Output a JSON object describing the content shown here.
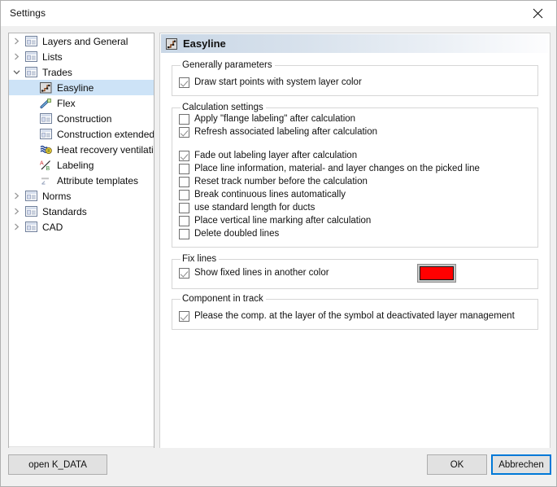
{
  "window": {
    "title": "Settings",
    "close_icon": "close-icon"
  },
  "tree": {
    "items": [
      {
        "label": "Layers and General",
        "level": 0,
        "expander": "collapsed",
        "icon": "window-list-icon",
        "selected": false
      },
      {
        "label": "Lists",
        "level": 0,
        "expander": "collapsed",
        "icon": "window-list-icon",
        "selected": false
      },
      {
        "label": "Trades",
        "level": 0,
        "expander": "expanded",
        "icon": "window-list-icon",
        "selected": false
      },
      {
        "label": "Easyline",
        "level": 1,
        "expander": "none",
        "icon": "easyline-icon",
        "selected": true
      },
      {
        "label": "Flex",
        "level": 1,
        "expander": "none",
        "icon": "flex-icon",
        "selected": false
      },
      {
        "label": "Construction",
        "level": 1,
        "expander": "none",
        "icon": "window-list-icon",
        "selected": false
      },
      {
        "label": "Construction extended",
        "level": 1,
        "expander": "none",
        "icon": "window-list-icon",
        "selected": false
      },
      {
        "label": "Heat recovery ventilation",
        "level": 1,
        "expander": "none",
        "icon": "heat-recovery-icon",
        "selected": false
      },
      {
        "label": "Labeling",
        "level": 1,
        "expander": "none",
        "icon": "labeling-icon",
        "selected": false
      },
      {
        "label": "Attribute templates",
        "level": 1,
        "expander": "none",
        "icon": "attribute-templates-icon",
        "selected": false
      },
      {
        "label": "Norms",
        "level": 0,
        "expander": "collapsed",
        "icon": "window-list-icon",
        "selected": false
      },
      {
        "label": "Standards",
        "level": 0,
        "expander": "collapsed",
        "icon": "window-list-icon",
        "selected": false
      },
      {
        "label": "CAD",
        "level": 0,
        "expander": "collapsed",
        "icon": "window-list-icon",
        "selected": false
      }
    ],
    "scrollbar": {
      "left_arrow": "‹",
      "right_arrow": "›"
    }
  },
  "panel": {
    "header_title": "Easyline",
    "header_icon": "easyline-icon",
    "groups": {
      "generally": {
        "legend": "Generally parameters",
        "items": [
          {
            "label": "Draw start points with system layer color",
            "checked": true
          }
        ]
      },
      "calculation": {
        "legend": "Calculation settings",
        "items": [
          {
            "label": "Apply \"flange labeling\" after calculation",
            "checked": false
          },
          {
            "label": "Refresh associated labeling after calculation",
            "checked": true
          },
          {
            "label": "Fade out labeling layer after calculation",
            "checked": true
          },
          {
            "label": "Place line information, material- and layer changes on the picked line",
            "checked": false
          },
          {
            "label": "Reset track number before the calculation",
            "checked": false
          },
          {
            "label": "Break continuous lines automatically",
            "checked": false
          },
          {
            "label": "use standard length for ducts",
            "checked": false
          },
          {
            "label": "Place vertical line marking after calculation",
            "checked": false
          },
          {
            "label": "Delete doubled lines",
            "checked": false
          }
        ]
      },
      "fix_lines": {
        "legend": "Fix lines",
        "items": [
          {
            "label": "Show fixed lines in another color",
            "checked": true
          }
        ],
        "swatch_color": "#ff0000"
      },
      "component_in_track": {
        "legend": "Component in track",
        "items": [
          {
            "label": "Please the comp. at the layer of the symbol at deactivated layer management",
            "checked": true
          }
        ]
      }
    }
  },
  "footer": {
    "open_data_label": "open K_DATA",
    "ok_label": "OK",
    "cancel_label": "Abbrechen",
    "focus_color": "#0078d7"
  }
}
